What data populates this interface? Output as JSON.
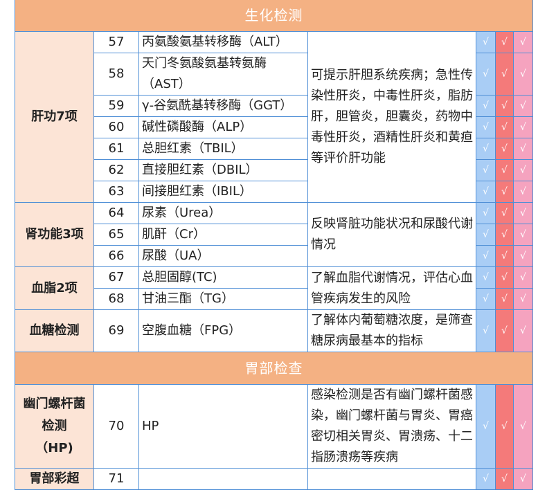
{
  "check_mark": "√",
  "sections": [
    {
      "title": "生化检测"
    },
    {
      "title": "胃部检查"
    }
  ],
  "liver": {
    "category": "肝功7项",
    "description": "可提示肝胆系统疾病；急性传染性肝炎，中毒性肝炎，脂肪肝，胆管炎，胆囊炎，药物中毒性肝炎，酒精性肝炎和黄疸等评价肝功能",
    "rows": [
      {
        "num": "57",
        "name": "丙氨酸氨基转移酶（ALT）"
      },
      {
        "num": "58",
        "name": "天门冬氨酸氨基转氨酶（AST）"
      },
      {
        "num": "59",
        "name": "γ-谷氨酰基转移酶（GGT）"
      },
      {
        "num": "60",
        "name": "碱性磷酸酶（ALP）"
      },
      {
        "num": "61",
        "name": "总胆红素（TBIL）"
      },
      {
        "num": "62",
        "name": "直接胆红素（DBIL）"
      },
      {
        "num": "63",
        "name": "间接胆红素（IBIL）"
      }
    ]
  },
  "kidney": {
    "category": "肾功能3项",
    "description": "反映肾脏功能状况和尿酸代谢情况",
    "rows": [
      {
        "num": "64",
        "name": "尿素（Urea）"
      },
      {
        "num": "65",
        "name": "肌酐（Cr）"
      },
      {
        "num": "66",
        "name": "尿酸（UA）"
      }
    ]
  },
  "lipid": {
    "category": "血脂2项",
    "description": "了解血脂代谢情况，评估心血管疾病发生的风险",
    "rows": [
      {
        "num": "67",
        "name": "总胆固醇(TC)"
      },
      {
        "num": "68",
        "name": "甘油三酯（TG）"
      }
    ]
  },
  "glucose": {
    "category": "血糖检测",
    "description": "了解体内葡萄糖浓度，是筛查糖尿病最基本的指标",
    "rows": [
      {
        "num": "69",
        "name": "空腹血糖（FPG）"
      }
    ]
  },
  "hp": {
    "category_line1": "幽门螺杆菌",
    "category_line2": "检测",
    "category_line3": "（HP)",
    "description": "感染检测是否有幽门螺杆菌感染，幽门螺杆菌与胃炎、胃癌密切相关胃炎、胃溃疡、十二指肠溃疡等疾病",
    "rows": [
      {
        "num": "70",
        "name": "HP"
      }
    ]
  },
  "ultrasound": {
    "category": "胃部彩超",
    "rows": [
      {
        "num": "71",
        "name": ""
      }
    ]
  },
  "colors": {
    "section_bg": "#f4b183",
    "category_bg": "#fce4d6",
    "border": "#4f8fd6",
    "col1": "#a9cdf5",
    "col2": "#f47a7a",
    "col3": "#f5a3bf"
  }
}
